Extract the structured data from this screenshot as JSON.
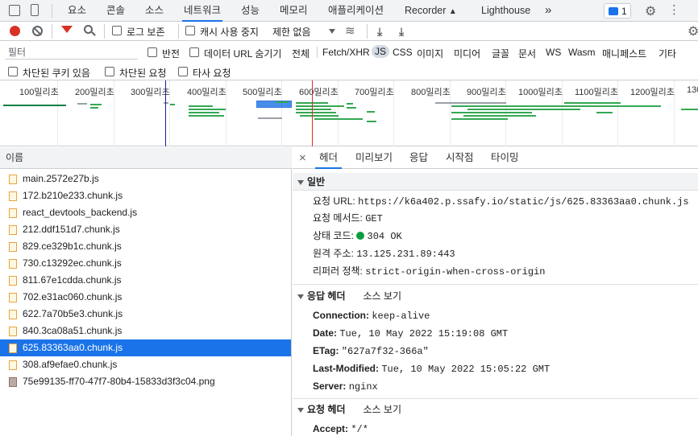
{
  "toolbar_top": {
    "tabs": [
      "요소",
      "콘솔",
      "소스",
      "네트워크",
      "성능",
      "메모리",
      "애플리케이션",
      "Recorder",
      "Lighthouse"
    ],
    "more": "»",
    "issues_count": "1"
  },
  "toolbar_network": {
    "preserve_log": "로그 보존",
    "disable_cache": "캐시 사용 중지",
    "throttle": "제한 없음"
  },
  "filter_bar": {
    "placeholder": "필터",
    "invert": "반전",
    "hide_data_urls": "데이터 URL 숨기기",
    "types": [
      "전체",
      "Fetch/XHR",
      "JS",
      "CSS",
      "이미지",
      "미디어",
      "글꼴",
      "문서",
      "WS",
      "Wasm",
      "매니페스트",
      "기타"
    ]
  },
  "filter_bar2": {
    "blocked_cookies": "차단된 쿠키 있음",
    "blocked_requests": "차단된 요청",
    "third_party": "타사 요청"
  },
  "overview": {
    "ticks": [
      "100밀리초",
      "200밀리초",
      "300밀리초",
      "400밀리초",
      "500밀리초",
      "600밀리초",
      "700밀리초",
      "800밀리초",
      "900밀리초",
      "1000밀리초",
      "1100밀리초",
      "1200밀리초",
      "130"
    ]
  },
  "request_list": {
    "header": "이름",
    "rows": [
      "main.2572e27b.js",
      "172.b210e233.chunk.js",
      "react_devtools_backend.js",
      "212.ddf151d7.chunk.js",
      "829.ce329b1c.chunk.js",
      "730.c13292ec.chunk.js",
      "811.67e1cdda.chunk.js",
      "702.e31ac060.chunk.js",
      "622.7a70b5e3.chunk.js",
      "840.3ca08a51.chunk.js",
      "625.83363aa0.chunk.js",
      "308.af9efae0.chunk.js",
      "75e99135-ff70-47f7-80b4-15833d3f3c04.png"
    ],
    "selected_index": 10
  },
  "detail": {
    "close": "×",
    "tabs": [
      "헤더",
      "미리보기",
      "응답",
      "시작점",
      "타이밍"
    ],
    "general": {
      "title": "일반",
      "url_label": "요청 URL:",
      "url": "https://k6a402.p.ssafy.io/static/js/625.83363aa0.chunk.js",
      "method_label": "요청 메서드:",
      "method": "GET",
      "status_label": "상태 코드:",
      "status": "304 OK",
      "remote_label": "원격 주소:",
      "remote": "13.125.231.89:443",
      "referrer_label": "리퍼러 정책:",
      "referrer": "strict-origin-when-cross-origin"
    },
    "response_headers": {
      "title": "응답 헤더",
      "view_source": "소스 보기",
      "items": [
        {
          "k": "Connection:",
          "v": "keep-alive"
        },
        {
          "k": "Date:",
          "v": "Tue, 10 May 2022 15:19:08 GMT"
        },
        {
          "k": "ETag:",
          "v": "\"627a7f32-366a\""
        },
        {
          "k": "Last-Modified:",
          "v": "Tue, 10 May 2022 15:05:22 GMT"
        },
        {
          "k": "Server:",
          "v": "nginx"
        }
      ]
    },
    "request_headers": {
      "title": "요청 헤더",
      "view_source": "소스 보기",
      "items": [
        {
          "k": "Accept:",
          "v": "*/*"
        }
      ]
    }
  },
  "colors": {
    "accent": "#1a73e8",
    "status_ok": "#0d9d3f",
    "record": "#d93025",
    "filter_icon": "#d93025"
  }
}
